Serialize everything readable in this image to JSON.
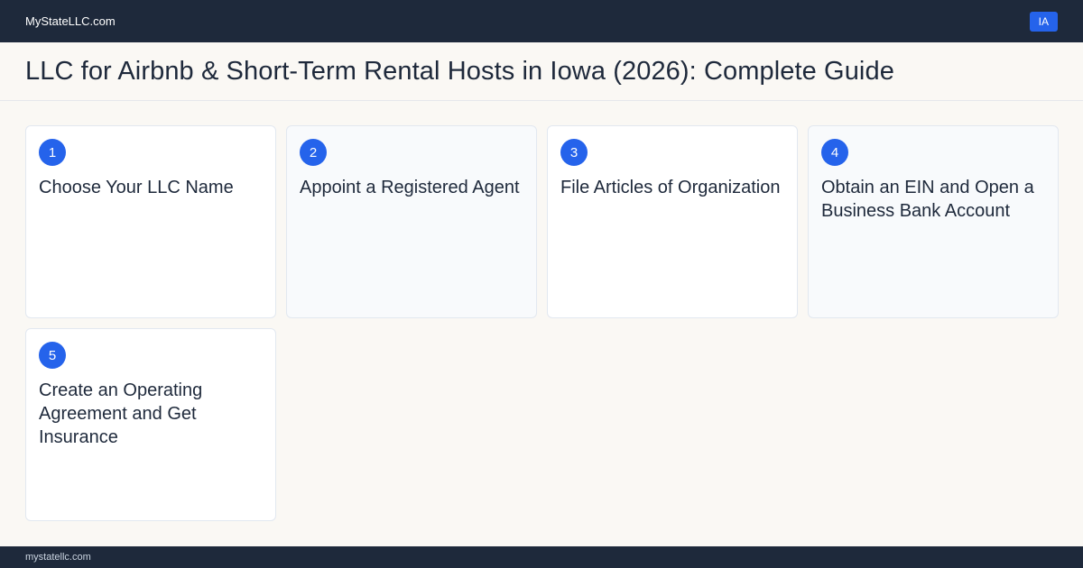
{
  "header": {
    "brand": "MyStateLLC.com",
    "state_badge": "IA"
  },
  "page": {
    "title": "LLC for Airbnb & Short-Term Rental Hosts in Iowa (2026): Complete Guide"
  },
  "steps": [
    {
      "number": "1",
      "title": "Choose Your LLC Name"
    },
    {
      "number": "2",
      "title": "Appoint a Registered Agent"
    },
    {
      "number": "3",
      "title": "File Articles of Organization"
    },
    {
      "number": "4",
      "title": "Obtain an EIN and Open a Business Bank Account"
    },
    {
      "number": "5",
      "title": "Create an Operating Agreement and Get Insurance"
    }
  ],
  "footer": {
    "domain": "mystatellc.com"
  },
  "colors": {
    "nav_bg": "#1e293b",
    "accent": "#2563eb",
    "page_bg": "#faf8f4"
  }
}
